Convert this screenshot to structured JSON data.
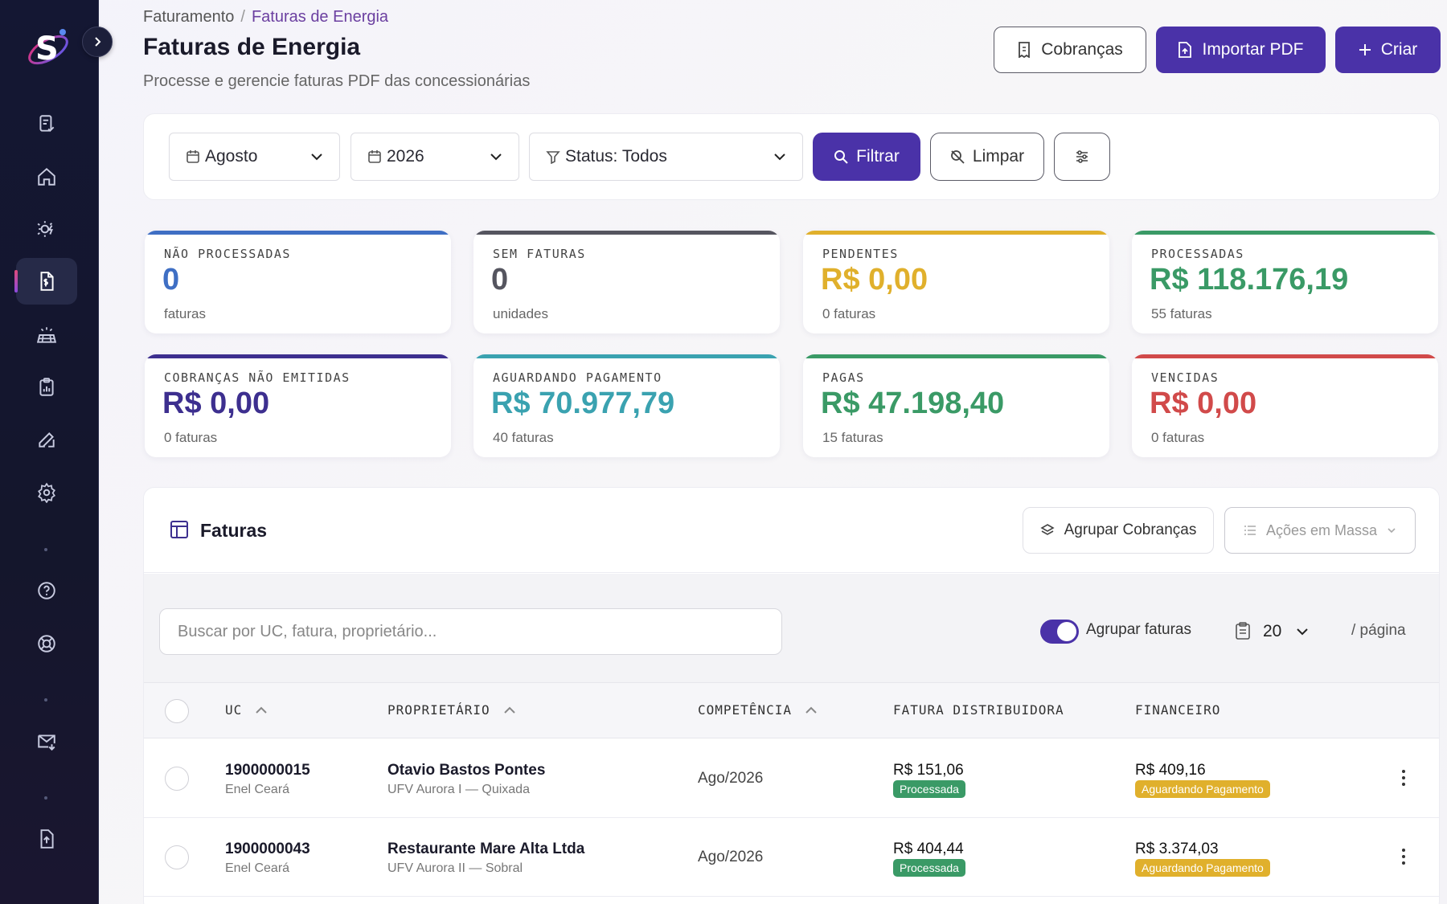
{
  "breadcrumb": {
    "parent": "Faturamento",
    "separator": "/",
    "current": "Faturas de Energia"
  },
  "header": {
    "title": "Faturas de Energia",
    "subtitle": "Processe e gerencie faturas PDF das concessionárias",
    "buttons": {
      "cobrancas": "Cobranças",
      "importar": "Importar PDF",
      "criar": "Criar"
    }
  },
  "filters": {
    "month": "Agosto",
    "year": "2026",
    "status": "Status: Todos",
    "filter_label": "Filtrar",
    "clear_label": "Limpar"
  },
  "stats": [
    {
      "label": "NÃO PROCESSADAS",
      "value": "0",
      "sub": "faturas",
      "color": "#3f6fc4"
    },
    {
      "label": "SEM FATURAS",
      "value": "0",
      "sub": "unidades",
      "color": "#55555f"
    },
    {
      "label": "PENDENTES",
      "value": "R$ 0,00",
      "sub": "0 faturas",
      "color": "#e0b02c"
    },
    {
      "label": "PROCESSADAS",
      "value": "R$ 118.176,19",
      "sub": "55 faturas",
      "color": "#3a9a66"
    },
    {
      "label": "COBRANÇAS NÃO EMITIDAS",
      "value": "R$ 0,00",
      "sub": "0 faturas",
      "color": "#3d2f8f"
    },
    {
      "label": "AGUARDANDO PAGAMENTO",
      "value": "R$ 70.977,79",
      "sub": "40 faturas",
      "color": "#3aa2b0"
    },
    {
      "label": "PAGAS",
      "value": "R$ 47.198,40",
      "sub": "15 faturas",
      "color": "#3a9a66"
    },
    {
      "label": "VENCIDAS",
      "value": "R$ 0,00",
      "sub": "0 faturas",
      "color": "#d14a4a"
    }
  ],
  "table": {
    "title": "Faturas",
    "group_button": "Agrupar Cobranças",
    "bulk_actions": "Ações em Massa",
    "search_placeholder": "Buscar por UC, fatura, proprietário...",
    "group_toggle_label": "Agrupar faturas",
    "group_toggle_on": true,
    "page_size": "20",
    "page_suffix": "/ página",
    "columns": [
      "UC",
      "PROPRIETÁRIO",
      "COMPETÊNCIA",
      "FATURA DISTRIBUIDORA",
      "FINANCEIRO"
    ],
    "rows": [
      {
        "uc": "1900000015",
        "distributor": "Enel Ceará",
        "owner": "Otavio Bastos Pontes",
        "plant": "UFV Aurora I — Quixada",
        "period": "Ago/2026",
        "invoice_value": "R$ 151,06",
        "invoice_status": "Processada",
        "financial_value": "R$ 409,16",
        "financial_status": "Aguardando Pagamento"
      },
      {
        "uc": "1900000043",
        "distributor": "Enel Ceará",
        "owner": "Restaurante Mare Alta Ltda",
        "plant": "UFV Aurora II — Sobral",
        "period": "Ago/2026",
        "invoice_value": "R$ 404,44",
        "invoice_status": "Processada",
        "financial_value": "R$ 3.374,03",
        "financial_status": "Aguardando Pagamento"
      }
    ]
  },
  "colors": {
    "primary": "#4a32a8",
    "badge_processed": "#3a9a66",
    "badge_awaiting": "#e0b02c",
    "sidebar_bg": "#141733"
  }
}
